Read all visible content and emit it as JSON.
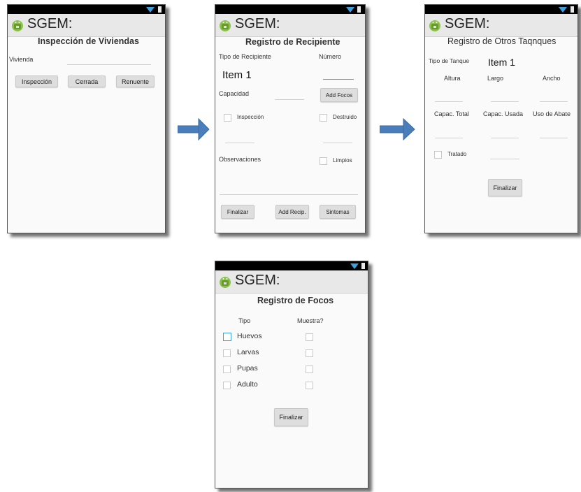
{
  "app_title": "SGEM:",
  "screen1": {
    "heading": "Inspección de Viviendas",
    "vivienda_label": "Vivienda",
    "buttons": [
      "Inspección",
      "Cerrada",
      "Renuente"
    ]
  },
  "screen2": {
    "heading": "Registro de Recipiente",
    "tipo_label": "Tipo de Recipiente",
    "numero_label": "Número",
    "tipo_value": "Item 1",
    "capacidad_label": "Capacidad",
    "add_focos_label": "Add Focos",
    "inspeccion_label": "Inspección",
    "destruido_label": "Destruido",
    "observaciones_label": "Observaciones",
    "limpios_label": "Limpios",
    "finalizar_label": "Finalizar",
    "add_recip_label": "Add Recip.",
    "sintomas_label": "Sintomas"
  },
  "screen3": {
    "heading": "Registro de Otros Taqnques",
    "tipo_tanque_label": "Tipo de Tanque",
    "tipo_tanque_value": "Item 1",
    "altura_label": "Altura",
    "largo_label": "Largo",
    "ancho_label": "Ancho",
    "capac_total_label": "Capac. Total",
    "capac_usada_label": "Capac. Usada",
    "uso_abate_label": "Uso de Abate",
    "tratado_label": "Tratado",
    "finalizar_label": "Finalizar"
  },
  "screen4": {
    "heading": "Registro de Focos",
    "tipo_header": "Tipo",
    "muestra_header": "Muestra?",
    "rows": [
      "Huevos",
      "Larvas",
      "Pupas",
      "Adulto"
    ],
    "finalizar_label": "Finalizar"
  },
  "colors": {
    "arrow": "#4a7ebb",
    "wifi": "#3fa0e0",
    "android": "#8bc34a"
  }
}
